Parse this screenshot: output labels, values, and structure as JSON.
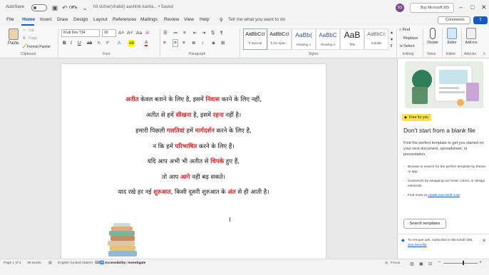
{
  "titlebar": {
    "autosave_label": "AutoSave",
    "autosave_state": "Off",
    "doc_title": "hit vichar(shabd) aashtrik kavita...  •  Saved",
    "avatar_initials": "SS",
    "buy_label": "Buy Microsoft 365"
  },
  "menu": {
    "tabs": [
      "File",
      "Home",
      "Insert",
      "Draw",
      "Design",
      "Layout",
      "References",
      "Mailings",
      "Review",
      "View",
      "Help"
    ],
    "active_tab": "Home",
    "tell_me": "Tell me what you want to do",
    "comments": "Comments",
    "share": "Share"
  },
  "ribbon": {
    "paste": "Paste",
    "cut": "Cut",
    "copy": "Copy",
    "format_painter": "Format Painter",
    "clipboard_group": "Clipboard",
    "font_name": "Kruti Dev 734",
    "font_size": "20",
    "font_group": "Font",
    "paragraph_group": "Paragraph",
    "styles": [
      {
        "sample": "AaBbCcI",
        "name": "¶ Normal"
      },
      {
        "sample": "AaBbCcI",
        "name": "¶ No Spac..."
      },
      {
        "sample": "AaBb(",
        "name": "Heading 1"
      },
      {
        "sample": "AaBbC",
        "name": "Heading 2"
      },
      {
        "sample": "AaB",
        "name": "Title"
      },
      {
        "sample": "AaBbCc",
        "name": "Subtitle"
      }
    ],
    "styles_group": "Styles",
    "find": "Find",
    "replace": "Replace",
    "select": "Select",
    "editing_group": "Editing",
    "dictate": "Dictate",
    "voice_group": "Voice",
    "editor": "Editor",
    "editor_group": "Editor",
    "addins": "Add-ins",
    "addins_group": "Add-ins"
  },
  "document": {
    "lines": [
      [
        {
          "t": "अतीत",
          "h": true
        },
        {
          "t": " केवल बताने के लिए है, इसमें ",
          "h": false
        },
        {
          "t": "निवास",
          "h": true
        },
        {
          "t": " करने के लिए नहीं,",
          "h": false
        }
      ],
      [
        {
          "t": "अतीत से हमें ",
          "h": false
        },
        {
          "t": "सीखना",
          "h": true
        },
        {
          "t": " है, इसमें ",
          "h": false
        },
        {
          "t": "रहना",
          "h": true
        },
        {
          "t": " नहीं है।",
          "h": false
        }
      ],
      [
        {
          "t": "हमारी पिछली ",
          "h": false
        },
        {
          "t": "गलतियां",
          "h": true
        },
        {
          "t": " हमें ",
          "h": false
        },
        {
          "t": "मार्गदर्शन",
          "h": true
        },
        {
          "t": " करने के लिए है,",
          "h": false
        }
      ],
      [
        {
          "t": "न कि हमें ",
          "h": false
        },
        {
          "t": "परिभाषित",
          "h": true
        },
        {
          "t": " करने के लिए हैं।",
          "h": false
        }
      ],
      [
        {
          "t": "यदि आप अभी भी अतीत से ",
          "h": false
        },
        {
          "t": "चिपके",
          "h": true
        },
        {
          "t": " हुए हैं,",
          "h": false
        }
      ],
      [
        {
          "t": "तो आप ",
          "h": false
        },
        {
          "t": "आगे",
          "h": true
        },
        {
          "t": " नहीं बढ़ सकते।",
          "h": false
        }
      ],
      [
        {
          "t": "याद रखे हर नई ",
          "h": false
        },
        {
          "t": "शुरुआत",
          "h": true
        },
        {
          "t": ", किसी दूसरी शुरुआत के ",
          "h": false
        },
        {
          "t": "अंत",
          "h": true
        },
        {
          "t": " से ही आती है।",
          "h": false
        }
      ]
    ]
  },
  "pane": {
    "free_badge": "Free for you",
    "title": "Don't start from a blank file",
    "body": "Find the perfect template to get you started on your next document, spreadsheet, or presentation.",
    "bullets": [
      "Browse or search for the perfect template by theme or app.",
      "Customize by swapping out fonts, colors, or design elements."
    ],
    "find_more_prefix": "Find more at ",
    "find_more_link": "create.microsoft.com",
    "button": "Search templates",
    "footer_line1": "To remove ads, subscribe to Microsoft 365.",
    "footer_link": "See benefits"
  },
  "status": {
    "page": "Page 1 of 1",
    "words": "49 words",
    "language": "English (United States)",
    "accessibility": "Accessibility: Investigate",
    "focus": "Focus"
  },
  "colors": {
    "accent": "#185abd",
    "highlight_text": "#e0242a",
    "free_badge": "#ffe14d"
  }
}
